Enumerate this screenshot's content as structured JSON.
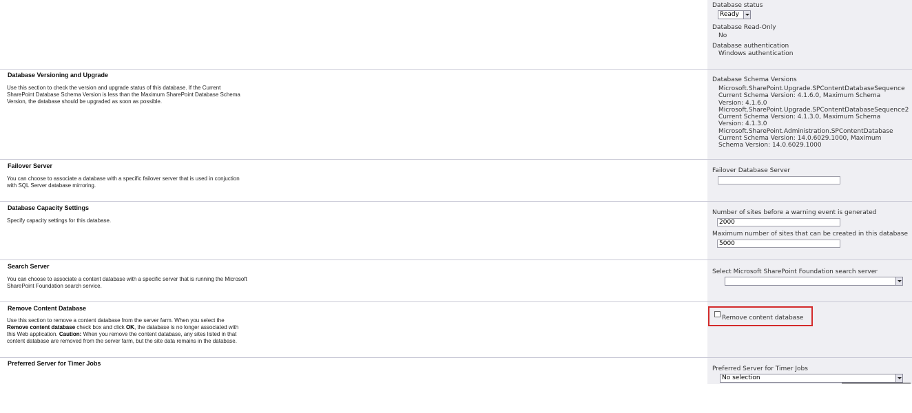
{
  "status_section": {
    "db_status_label": "Database status",
    "db_status_value": "Ready",
    "readonly_label": "Database Read-Only",
    "readonly_value": "No",
    "auth_label": "Database authentication",
    "auth_value": "Windows authentication"
  },
  "versioning": {
    "title": "Database Versioning and Upgrade",
    "desc_1": "Use this section to check the version and upgrade status of this database. If the Current",
    "desc_2": "SharePoint Database Schema Version is less than the Maximum SharePoint Database Schema",
    "desc_3": "Version, the database should be upgraded as soon as possible.",
    "schema_label": "Database Schema Versions",
    "schema_lines": [
      "Microsoft.SharePoint.Upgrade.SPContentDatabaseSequence",
      "Current Schema Version: 4.1.6.0, Maximum Schema",
      "Version: 4.1.6.0",
      "Microsoft.SharePoint.Upgrade.SPContentDatabaseSequence2",
      "Current Schema Version: 4.1.3.0, Maximum Schema",
      "Version: 4.1.3.0",
      "Microsoft.SharePoint.Administration.SPContentDatabase",
      "Current Schema Version: 14.0.6029.1000, Maximum",
      "Schema Version: 14.0.6029.1000"
    ]
  },
  "failover": {
    "title": "Failover Server",
    "desc_1": "You can choose to associate a database with a specific failover server that is used in conjuction",
    "desc_2": "with SQL Server database mirroring.",
    "field_label": "Failover Database Server",
    "field_value": ""
  },
  "capacity": {
    "title": "Database Capacity Settings",
    "desc_1": "Specify capacity settings for this database.",
    "warning_label": "Number of sites before a warning event is generated",
    "warning_value": "2000",
    "max_label": "Maximum number of sites that can be created in this database",
    "max_value": "5000"
  },
  "search": {
    "title": "Search Server",
    "desc_1": "You can choose to associate a content database with a specific server that is running the Microsoft",
    "desc_2": "SharePoint Foundation search service.",
    "field_label": "Select Microsoft SharePoint Foundation search server",
    "field_value": ""
  },
  "remove": {
    "title": "Remove Content Database",
    "desc_1_a": "Use this section to remove a content database from the server farm. When you select the",
    "desc_2_bold": "Remove content database",
    "desc_2_mid": " check box and click ",
    "desc_2_ok": "OK",
    "desc_2_end": ", the database is no longer associated with",
    "desc_3_a": "this Web application. ",
    "desc_3_caution": "Caution:",
    "desc_3_end": " When you remove the content database, any sites listed in that",
    "desc_4": "content database are removed from the server farm, but the site data remains in the database.",
    "checkbox_label": "Remove content database",
    "checked": false,
    "highlight_color": "#d32a2a"
  },
  "timer": {
    "title": "Preferred Server for Timer Jobs",
    "field_label": "Preferred Server for Timer Jobs",
    "field_value": "No selection"
  }
}
